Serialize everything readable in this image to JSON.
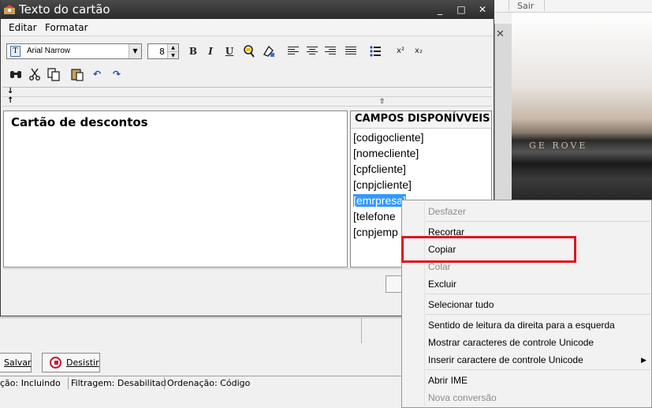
{
  "background": {
    "top_bar_label": "Sair",
    "car_badge_text": "GE ROVE",
    "buttons": {
      "save": "Salvar",
      "cancel": "Desistir"
    },
    "status": [
      "ção: Incluindo",
      "Filtragem: Desabilitad",
      "Ordenação: Código"
    ]
  },
  "dialog": {
    "title": "Texto do cartão",
    "window_buttons": {
      "minimize": "_",
      "maximize": "□",
      "close": "✕"
    },
    "menu": {
      "edit": "Editar",
      "format": "Formatar"
    },
    "font": {
      "name": "Arial Narrow",
      "size": "8"
    },
    "format_buttons": {
      "bold": "B",
      "italic": "I",
      "underline": "U"
    },
    "editor_text": "Cartão de descontos",
    "fields_header": "CAMPOS DISPONÍVVEIS",
    "fields": [
      "[codigocliente]",
      "[nomecliente]",
      "[cpfcliente]",
      "[cnpjcliente]",
      "[emrpresa]",
      "[telefone",
      "[cnpjemp"
    ],
    "selected_field_index": 4
  },
  "context_menu": {
    "items": [
      {
        "label": "Desfazer",
        "enabled": false
      },
      {
        "label": "Recortar",
        "enabled": true
      },
      {
        "label": "Copiar",
        "enabled": true,
        "highlighted": true
      },
      {
        "label": "Colar",
        "enabled": false
      },
      {
        "label": "Excluir",
        "enabled": true
      },
      {
        "label": "Selecionar tudo",
        "enabled": true
      },
      {
        "label": "Sentido de leitura da direita para a esquerda",
        "enabled": true
      },
      {
        "label": "Mostrar caracteres de controle Unicode",
        "enabled": true
      },
      {
        "label": "Inserir caractere de controle Unicode",
        "enabled": true,
        "submenu": true
      },
      {
        "label": "Abrir IME",
        "enabled": true
      },
      {
        "label": "Nova conversão",
        "enabled": false
      }
    ]
  },
  "colors": {
    "highlight_border": "#e0141e",
    "selection": "#3399ff",
    "titlebar": "#2b2b2b"
  }
}
